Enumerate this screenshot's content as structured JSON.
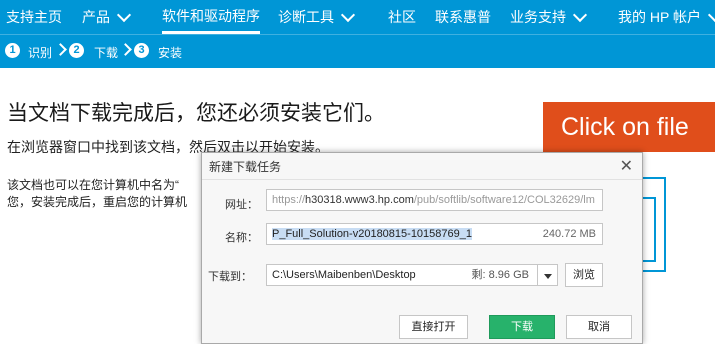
{
  "topnav": {
    "items": [
      {
        "label": "支持主页",
        "has_chevron": false
      },
      {
        "label": "产品",
        "has_chevron": true
      },
      {
        "label": "软件和驱动程序",
        "has_chevron": false,
        "active": true
      },
      {
        "label": "诊断工具",
        "has_chevron": true
      },
      {
        "label": "社区",
        "has_chevron": false
      },
      {
        "label": "联系惠普",
        "has_chevron": false
      },
      {
        "label": "业务支持",
        "has_chevron": true
      },
      {
        "label": "我的 HP 帐户",
        "has_chevron": true
      }
    ]
  },
  "steps": [
    {
      "num": "1",
      "label": "识别"
    },
    {
      "num": "2",
      "label": "下载"
    },
    {
      "num": "3",
      "label": "安装"
    }
  ],
  "main": {
    "headline": "当文档下载完成后，您还必须安装它们。",
    "subline": "在浏览器窗口中找到该文档，然后双击以开始安装。",
    "para_line1": "该文档也可以在您计算机中名为“",
    "para_line2": "您，安装完成后，重启您的计算机"
  },
  "banner": {
    "text": "Click on file"
  },
  "dialog": {
    "title": "新建下载任务",
    "url_label": "网址：",
    "url_prefix": "https://",
    "url_host": "h30318.www3.hp.com",
    "url_path": "/pub/softlib/software12/COL32629/lm",
    "name_label": "名称：",
    "name_value": "P_Full_Solution-v20180815-10158769_1",
    "name_size": "240.72 MB",
    "path_label": "下载到：",
    "path_value": "C:\\Users\\Maibenben\\Desktop",
    "path_free": "剩: 8.96 GB",
    "browse_label": "浏览",
    "open_label": "直接打开",
    "download_label": "下载",
    "cancel_label": "取消"
  },
  "colors": {
    "nav_blue": "#0096d6",
    "banner_orange": "#e04e1b",
    "download_green": "#27b26b"
  }
}
